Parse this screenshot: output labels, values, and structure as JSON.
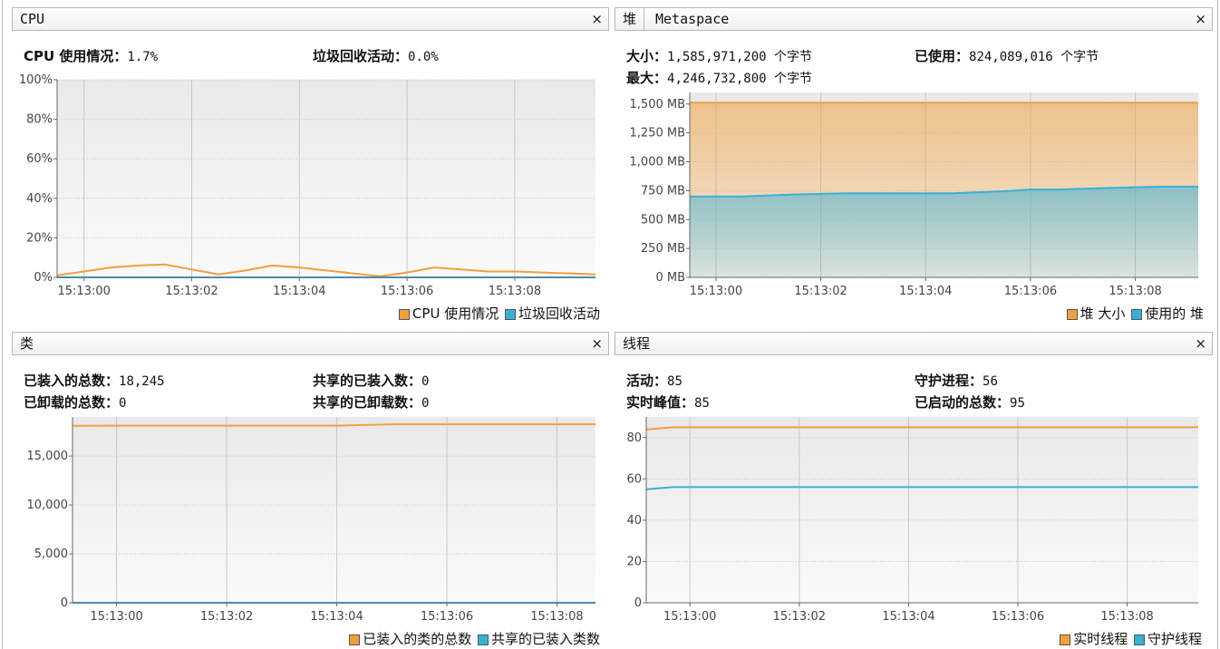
{
  "colors": {
    "orange": "#f0a040",
    "blue": "#3ab0d8"
  },
  "panels": {
    "cpu": {
      "title": "CPU",
      "close": "×",
      "stats": [
        {
          "label": "CPU 使用情况：",
          "value": "1.7%"
        },
        {
          "label": "垃圾回收活动：",
          "value": "0.0%"
        }
      ],
      "legend": [
        "CPU 使用情况",
        "垃圾回收活动"
      ]
    },
    "heap": {
      "title": "堆",
      "subtab": "Metaspace",
      "close": "×",
      "stats": [
        {
          "label": "大小：",
          "value": "1,585,971,200 个字节"
        },
        {
          "label": "已使用：",
          "value": "824,089,016 个字节"
        },
        {
          "label": "最大：",
          "value": "4,246,732,800 个字节"
        }
      ],
      "legend": [
        "堆 大小",
        "使用的 堆"
      ]
    },
    "classes": {
      "title": "类",
      "close": "×",
      "stats": [
        {
          "label": "已装入的总数：",
          "value": "18,245"
        },
        {
          "label": "共享的已装入数：",
          "value": "0"
        },
        {
          "label": "已卸载的总数：",
          "value": "0"
        },
        {
          "label": "共享的已卸载数：",
          "value": "0"
        }
      ],
      "legend": [
        "已装入的类的总数",
        "共享的已装入类数"
      ]
    },
    "threads": {
      "title": "线程",
      "close": "×",
      "stats": [
        {
          "label": "活动：",
          "value": "85"
        },
        {
          "label": "守护进程：",
          "value": "56"
        },
        {
          "label": "实时峰值：",
          "value": "85"
        },
        {
          "label": "已启动的总数：",
          "value": "95"
        }
      ],
      "legend": [
        "实时线程",
        "守护线程"
      ]
    }
  },
  "chart_data": [
    {
      "id": "cpu",
      "type": "line",
      "ylim": [
        0,
        100
      ],
      "xlim": [
        -0.5,
        9.5
      ],
      "yticks": [
        0,
        20,
        40,
        60,
        80,
        100
      ],
      "ytick_labels": [
        "0%",
        "20%",
        "40%",
        "60%",
        "80%",
        "100%"
      ],
      "xticks": [
        0,
        2,
        4,
        6,
        8
      ],
      "xtick_labels": [
        "15:13:00",
        "15:13:02",
        "15:13:04",
        "15:13:06",
        "15:13:08"
      ],
      "series": [
        {
          "name": "CPU 使用情况",
          "color": "#f0a040",
          "fill": false,
          "x": [
            -0.5,
            0,
            0.5,
            1,
            1.5,
            2,
            2.5,
            3,
            3.5,
            4,
            4.5,
            5,
            5.5,
            6,
            6.5,
            7,
            7.5,
            8,
            8.5,
            9,
            9.5
          ],
          "y": [
            1,
            3,
            5,
            6,
            6.5,
            4,
            1.5,
            3.5,
            6,
            5,
            3.5,
            2,
            0.5,
            2.5,
            5,
            4,
            3,
            3,
            2.5,
            2,
            1.5
          ]
        },
        {
          "name": "垃圾回收活动",
          "color": "#3ab0d8",
          "fill": false,
          "x": [
            -0.5,
            9.5
          ],
          "y": [
            0,
            0
          ]
        }
      ]
    },
    {
      "id": "heap",
      "type": "area",
      "ylim": [
        0,
        1600
      ],
      "xlim": [
        -0.5,
        9.2
      ],
      "yticks": [
        0,
        250,
        500,
        750,
        1000,
        1250,
        1500
      ],
      "ytick_labels": [
        "0 MB",
        "250 MB",
        "500 MB",
        "750 MB",
        "1,000 MB",
        "1,250 MB",
        "1,500 MB"
      ],
      "xticks": [
        0,
        2,
        4,
        6,
        8
      ],
      "xtick_labels": [
        "15:13:00",
        "15:13:02",
        "15:13:04",
        "15:13:06",
        "15:13:08"
      ],
      "series": [
        {
          "name": "堆 大小",
          "color": "#f0a040",
          "fill": true,
          "x": [
            -0.5,
            9.2
          ],
          "y": [
            1512,
            1512
          ]
        },
        {
          "name": "使用的 堆",
          "color": "#3ab0d8",
          "fill": true,
          "x": [
            -0.5,
            0.5,
            1.5,
            2.5,
            3.5,
            4.5,
            5.5,
            6,
            6.5,
            7.5,
            8.5,
            9.2
          ],
          "y": [
            700,
            700,
            718,
            728,
            728,
            728,
            745,
            760,
            760,
            773,
            785,
            785
          ]
        }
      ]
    },
    {
      "id": "classes",
      "type": "line",
      "ylim": [
        0,
        19000
      ],
      "xlim": [
        -0.8,
        8.7
      ],
      "yticks": [
        0,
        5000,
        10000,
        15000
      ],
      "ytick_labels": [
        "0",
        "5,000",
        "10,000",
        "15,000"
      ],
      "xticks": [
        0,
        2,
        4,
        6,
        8
      ],
      "xtick_labels": [
        "15:13:00",
        "15:13:02",
        "15:13:04",
        "15:13:06",
        "15:13:08"
      ],
      "series": [
        {
          "name": "已装入的类的总数",
          "color": "#f0a040",
          "fill": false,
          "x": [
            -0.8,
            4,
            5,
            8.7
          ],
          "y": [
            18100,
            18110,
            18245,
            18245
          ]
        },
        {
          "name": "共享的已装入类数",
          "color": "#3ab0d8",
          "fill": false,
          "x": [
            -0.8,
            8.7
          ],
          "y": [
            0,
            0
          ]
        }
      ]
    },
    {
      "id": "threads",
      "type": "line",
      "ylim": [
        0,
        90
      ],
      "xlim": [
        -0.8,
        9.3
      ],
      "yticks": [
        0,
        20,
        40,
        60,
        80
      ],
      "ytick_labels": [
        "0",
        "20",
        "40",
        "60",
        "80"
      ],
      "xticks": [
        0,
        2,
        4,
        6,
        8
      ],
      "xtick_labels": [
        "15:13:00",
        "15:13:02",
        "15:13:04",
        "15:13:06",
        "15:13:08"
      ],
      "series": [
        {
          "name": "实时线程",
          "color": "#f0a040",
          "fill": false,
          "x": [
            -0.8,
            -0.3,
            9.3
          ],
          "y": [
            84,
            85,
            85
          ]
        },
        {
          "name": "守护线程",
          "color": "#3ab0d8",
          "fill": false,
          "x": [
            -0.8,
            -0.3,
            9.3
          ],
          "y": [
            55,
            56,
            56
          ]
        }
      ]
    }
  ]
}
